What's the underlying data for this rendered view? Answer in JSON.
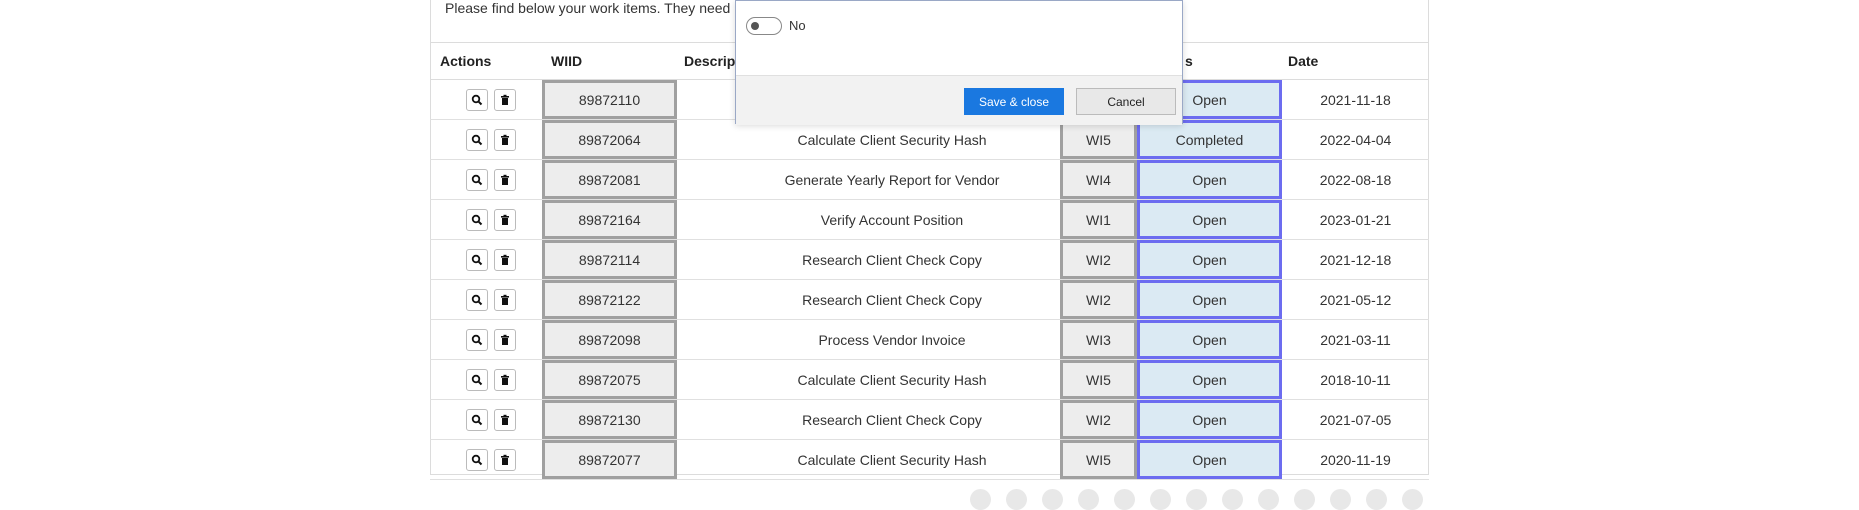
{
  "intro_text": "Please find below your work items. They need",
  "table": {
    "headers": {
      "actions": "Actions",
      "wiid": "WIID",
      "description": "Descrip",
      "status": "s",
      "date": "Date"
    },
    "rows": [
      {
        "wiid": "89872110",
        "description": "",
        "type": "",
        "status": "Open",
        "date": "2021-11-18"
      },
      {
        "wiid": "89872064",
        "description": "Calculate Client Security Hash",
        "type": "WI5",
        "status": "Completed",
        "date": "2022-04-04"
      },
      {
        "wiid": "89872081",
        "description": "Generate Yearly Report for Vendor",
        "type": "WI4",
        "status": "Open",
        "date": "2022-08-18"
      },
      {
        "wiid": "89872164",
        "description": "Verify Account Position",
        "type": "WI1",
        "status": "Open",
        "date": "2023-01-21"
      },
      {
        "wiid": "89872114",
        "description": "Research Client Check Copy",
        "type": "WI2",
        "status": "Open",
        "date": "2021-12-18"
      },
      {
        "wiid": "89872122",
        "description": "Research Client Check Copy",
        "type": "WI2",
        "status": "Open",
        "date": "2021-05-12"
      },
      {
        "wiid": "89872098",
        "description": "Process Vendor Invoice",
        "type": "WI3",
        "status": "Open",
        "date": "2021-03-11"
      },
      {
        "wiid": "89872075",
        "description": "Calculate Client Security Hash",
        "type": "WI5",
        "status": "Open",
        "date": "2018-10-11"
      },
      {
        "wiid": "89872130",
        "description": "Research Client Check Copy",
        "type": "WI2",
        "status": "Open",
        "date": "2021-07-05"
      },
      {
        "wiid": "89872077",
        "description": "Calculate Client Security Hash",
        "type": "WI5",
        "status": "Open",
        "date": "2020-11-19"
      }
    ]
  },
  "modal": {
    "toggle_label": "No",
    "save_label": "Save & close",
    "cancel_label": "Cancel"
  },
  "icons": {
    "view": "magnifier-icon",
    "delete": "trash-icon"
  },
  "colors": {
    "accent": "#1a78e0",
    "status_border": "#6c6cf0",
    "status_bg": "#dbeaf3"
  }
}
